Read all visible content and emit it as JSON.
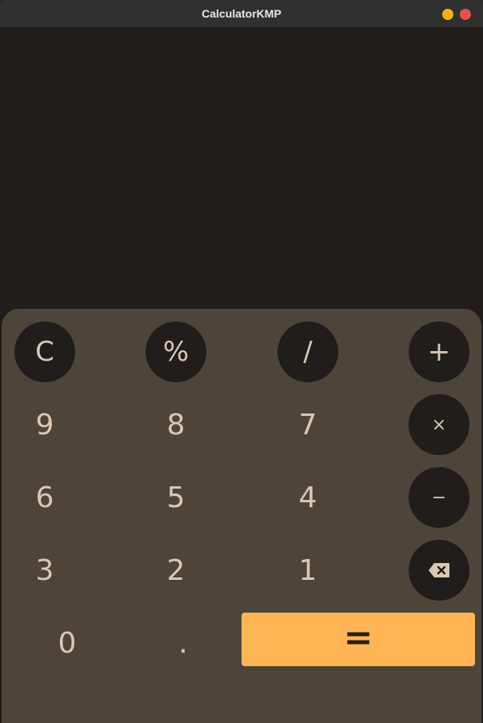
{
  "window": {
    "title": "CalculatorKMP",
    "controls": {
      "minimize_color": "#f6b21a",
      "close_color": "#e8524a"
    }
  },
  "display": {
    "expression": "",
    "result": ""
  },
  "keypad": {
    "row1": {
      "clear": "C",
      "percent": "%",
      "divide": "/",
      "add": "+"
    },
    "row2": {
      "nine": "9",
      "eight": "8",
      "seven": "7",
      "multiply": "×"
    },
    "row3": {
      "six": "6",
      "five": "5",
      "four": "4",
      "subtract": "−"
    },
    "row4": {
      "three": "3",
      "two": "2",
      "one": "1",
      "backspace_icon": "backspace-icon"
    },
    "row5": {
      "zero": "0",
      "decimal": ".",
      "equals": "="
    }
  },
  "colors": {
    "display_bg": "#201d1a",
    "keypad_bg": "#4d4539",
    "key_circle_bg": "#201d1a",
    "key_text": "#d9c8b6",
    "equals_bg": "#ffb456"
  }
}
